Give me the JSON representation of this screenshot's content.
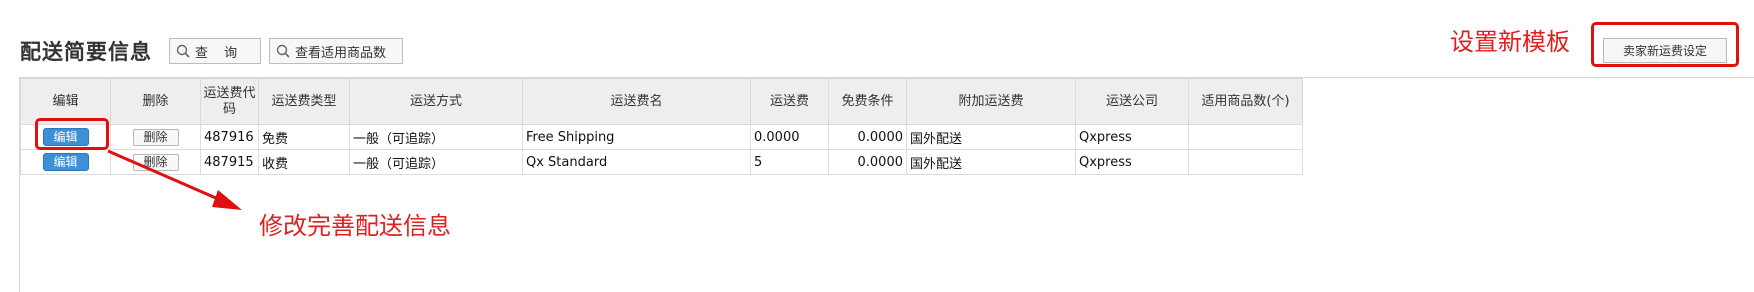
{
  "page": {
    "title": "配送简要信息",
    "query_label": "查 询",
    "applicable_products_label": "查看适用商品数",
    "new_template_label": "卖家新运费设定"
  },
  "annotations": {
    "new_template": "设置新模板",
    "edit_info": "修改完善配送信息",
    "color": "#e02020"
  },
  "table": {
    "headers": [
      "编辑",
      "删除",
      "运送费代码",
      "运送费类型",
      "运送方式",
      "运送费名",
      "运送费",
      "免费条件",
      "附加运送费",
      "运送公司",
      "适用商品数(个)"
    ],
    "rows": [
      {
        "edit": "编辑",
        "delete": "删除",
        "code": "487916",
        "type": "免费",
        "method": "一般（可追踪）",
        "name": "Free Shipping",
        "fee": "0.0000",
        "free_condition": "0.0000",
        "extra": "国外配送",
        "carrier": "Qxpress",
        "count": ""
      },
      {
        "edit": "编辑",
        "delete": "删除",
        "code": "487915",
        "type": "收费",
        "method": "一般（可追踪）",
        "name": "Qx Standard",
        "fee": "5",
        "free_condition": "0.0000",
        "extra": "国外配送",
        "carrier": "Qxpress",
        "count": ""
      }
    ]
  },
  "colors": {
    "edit_button": "#3d8fd6",
    "header_bg": "#eeeeee",
    "highlight": "#e01010"
  },
  "icons": [
    "search-icon",
    "search-icon"
  ]
}
